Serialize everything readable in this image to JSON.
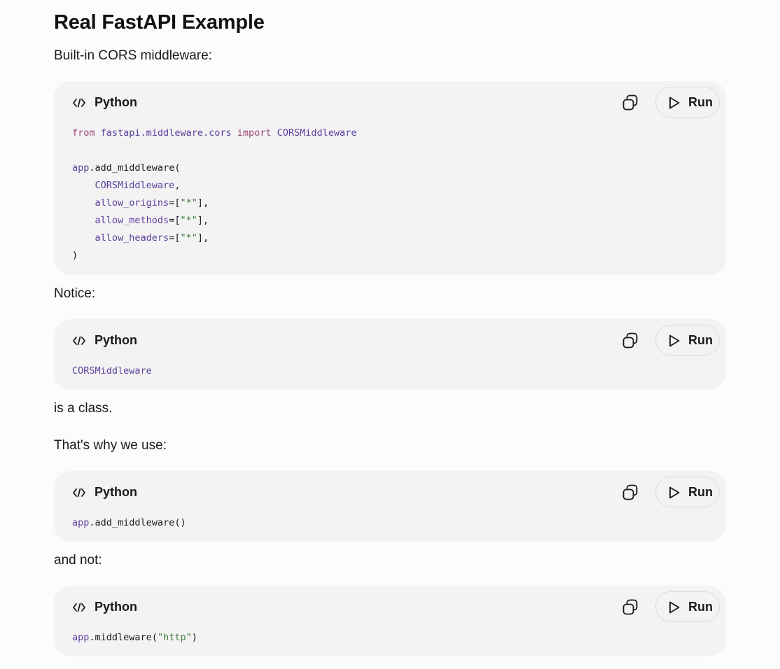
{
  "heading": "Real FastAPI Example",
  "paragraphs": {
    "intro": "Built-in CORS middleware:",
    "notice": "Notice:",
    "is_class": "is a class.",
    "why": "That's why we use:",
    "and_not": "and not:"
  },
  "code_block_ui": {
    "language_label": "Python",
    "language_icon": "code-brackets-icon",
    "copy_icon": "copy-icon",
    "run_label": "Run",
    "run_icon": "play-icon"
  },
  "code": {
    "block1": {
      "line1": {
        "kw1": "from",
        "module": "fastapi.middleware.cors",
        "kw2": "import",
        "cls": "CORSMiddleware"
      },
      "line3": {
        "obj": "app",
        "dot": ".",
        "call": "add_middleware("
      },
      "line4": {
        "cls": "CORSMiddleware",
        "comma": ","
      },
      "line5": {
        "kwarg": "allow_origins",
        "eq": "=",
        "open": "[",
        "str": "\"*\"",
        "close": "],"
      },
      "line6": {
        "kwarg": "allow_methods",
        "eq": "=",
        "open": "[",
        "str": "\"*\"",
        "close": "],"
      },
      "line7": {
        "kwarg": "allow_headers",
        "eq": "=",
        "open": "[",
        "str": "\"*\"",
        "close": "],"
      },
      "line8": {
        "close": ")"
      }
    },
    "block2": {
      "line1": {
        "cls": "CORSMiddleware"
      }
    },
    "block3": {
      "line1": {
        "obj": "app",
        "dot": ".",
        "call": "add_middleware()"
      }
    },
    "block4": {
      "line1": {
        "obj": "app",
        "dot": ".",
        "call": "middleware(",
        "str": "\"http\"",
        "close": ")"
      }
    }
  },
  "colors": {
    "page_background": "#fcfcfc",
    "code_background": "#f3f3f3",
    "keyword": "#9b4a78",
    "class_name": "#5b3f9e",
    "string": "#3c7a3c"
  }
}
